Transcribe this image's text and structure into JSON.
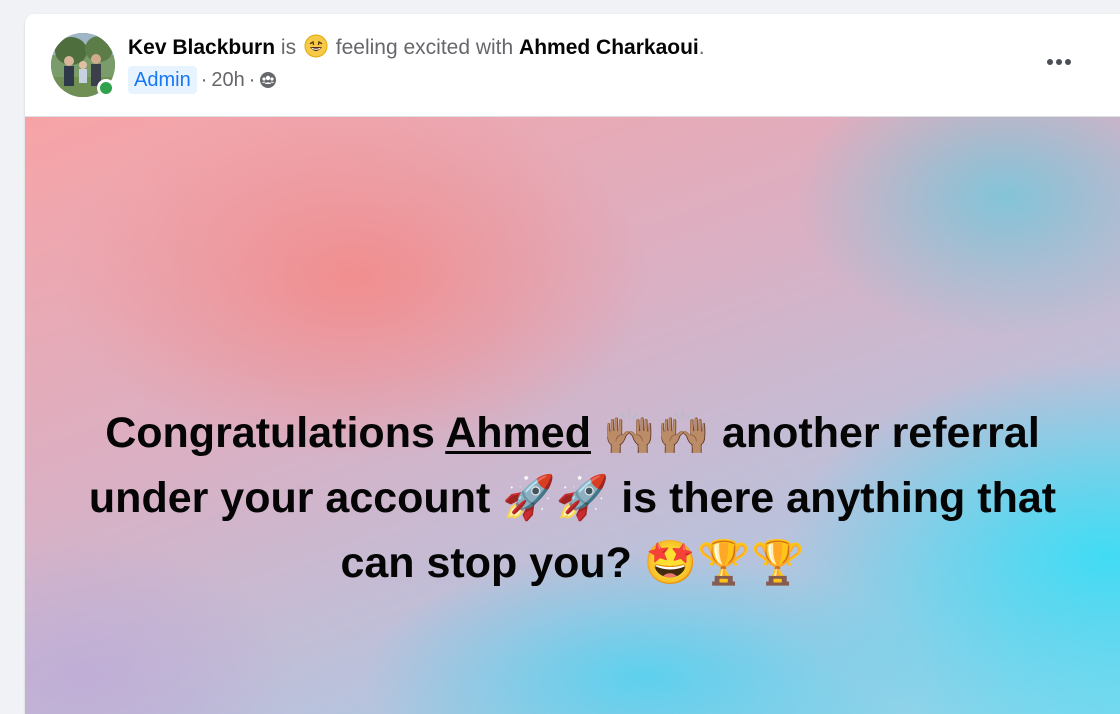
{
  "post": {
    "author_name": "Kev Blackburn",
    "is_text": "is",
    "feeling_text": "feeling excited with",
    "tagged_name": "Ahmed Charkaoui",
    "period": ".",
    "role_badge": "Admin",
    "separator1": "·",
    "timestamp": "20h",
    "separator2": "·",
    "audience_icon": "group-icon",
    "more_icon": "more-options-icon",
    "online_status_color": "#31a24c"
  },
  "banner": {
    "text_before_mention": "Congratulations ",
    "mention": "Ahmed",
    "text_after_mention": " 🙌🏽🙌🏽 another referral under your account 🚀🚀 is there anything that can stop you? 🤩🏆🏆"
  },
  "colors": {
    "accent_blue": "#1877f2",
    "badge_bg": "#e7f3ff",
    "secondary_text": "#65676b",
    "primary_text": "#050505"
  }
}
